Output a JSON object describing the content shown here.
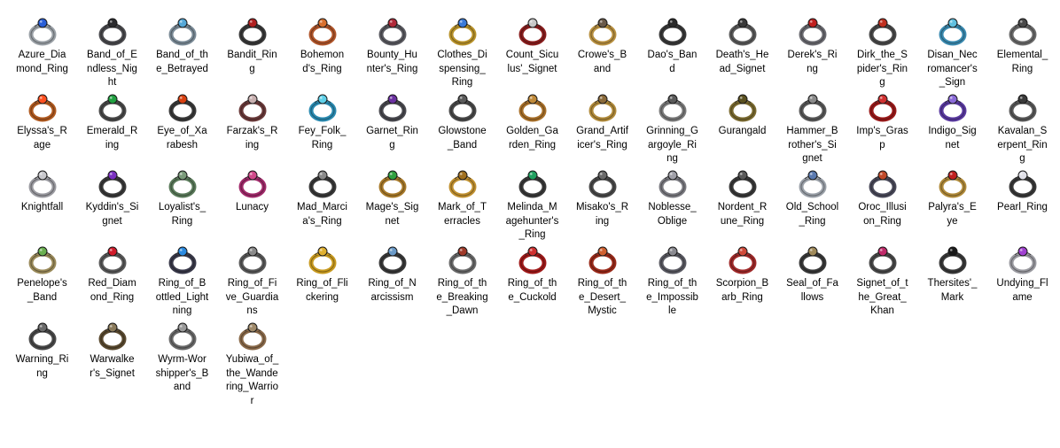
{
  "view": {
    "name": "ring-icons-folder"
  },
  "items": [
    {
      "name": "Azure_Diamond_Ring",
      "icon": "ring-icon",
      "metal": "#9aa0a6",
      "gem": "#2a5fd8"
    },
    {
      "name": "Band_of_Endless_Night",
      "icon": "ring-icon",
      "metal": "#4a4a4e",
      "gem": "#2b2b2e"
    },
    {
      "name": "Band_of_the_Betrayed",
      "icon": "ring-icon",
      "metal": "#7a8a96",
      "gem": "#55a8d8"
    },
    {
      "name": "Bandit_Ring",
      "icon": "ring-icon",
      "metal": "#3a3a3a",
      "gem": "#b02020"
    },
    {
      "name": "Bohemond's_Ring",
      "icon": "ring-icon",
      "metal": "#b0552a",
      "gem": "#d9702e"
    },
    {
      "name": "Bounty_Hunter's_Ring",
      "icon": "ring-icon",
      "metal": "#5a5a60",
      "gem": "#b02a3a"
    },
    {
      "name": "Clothes_Dispensing_Ring",
      "icon": "ring-icon",
      "metal": "#b8922a",
      "gem": "#3a7ad8"
    },
    {
      "name": "Count_Siculus'_Signet",
      "icon": "ring-icon",
      "metal": "#8a1e1e",
      "gem": "#c8c8c8"
    },
    {
      "name": "Crowe's_Band",
      "icon": "ring-icon",
      "metal": "#b89040",
      "gem": "#6a5a4a"
    },
    {
      "name": "Dao's_Band",
      "icon": "ring-icon",
      "metal": "#3a3a3a",
      "gem": "#2a2a2a"
    },
    {
      "name": "Death's_Head_Signet",
      "icon": "ring-icon",
      "metal": "#5a5a5a",
      "gem": "#3a3a3a"
    },
    {
      "name": "Derek's_Ring",
      "icon": "ring-icon",
      "metal": "#6a6a70",
      "gem": "#c02020"
    },
    {
      "name": "Dirk_the_Spider's_Ring",
      "icon": "ring-icon",
      "metal": "#4a4a4a",
      "gem": "#c03020"
    },
    {
      "name": "Disan_Necromancer's_Sign",
      "icon": "ring-icon",
      "metal": "#3a8ab0",
      "gem": "#60c0e0"
    },
    {
      "name": "Elemental_Ring",
      "icon": "ring-icon",
      "metal": "#6a6a6a",
      "gem": "#4a4a4a"
    },
    {
      "name": "Elyssa's_Rage",
      "icon": "ring-icon",
      "metal": "#b05a20",
      "gem": "#ff5020"
    },
    {
      "name": "Emerald_Ring",
      "icon": "ring-icon",
      "metal": "#4a4a4a",
      "gem": "#20a040"
    },
    {
      "name": "Eye_of_Xarabesh",
      "icon": "ring-icon",
      "metal": "#3a3a3a",
      "gem": "#d84010"
    },
    {
      "name": "Farzak's_Ring",
      "icon": "ring-icon",
      "metal": "#6a3a3a",
      "gem": "#c8b0b0"
    },
    {
      "name": "Fey_Folk_Ring",
      "icon": "ring-icon",
      "metal": "#2a8ab0",
      "gem": "#60d0e8"
    },
    {
      "name": "Garnet_Ring",
      "icon": "ring-icon",
      "metal": "#4a4a50",
      "gem": "#6a30a0"
    },
    {
      "name": "Glowstone_Band",
      "icon": "ring-icon",
      "metal": "#4a4a4a",
      "gem": "#5a5a5a"
    },
    {
      "name": "Golden_Garden_Ring",
      "icon": "ring-icon",
      "metal": "#a8702a",
      "gem": "#c08a3a"
    },
    {
      "name": "Grand_Artificer's_Ring",
      "icon": "ring-icon",
      "metal": "#b08a3a",
      "gem": "#8a6a3a"
    },
    {
      "name": "Grinning_Gargoyle_Ring",
      "icon": "ring-icon",
      "metal": "#7a7a7a",
      "gem": "#5a5a5a"
    },
    {
      "name": "Gurangald",
      "icon": "ring-icon",
      "metal": "#7a6a30",
      "gem": "#5a5020"
    },
    {
      "name": "Hammer_Brother's_Signet",
      "icon": "ring-icon",
      "metal": "#5a5a5a",
      "gem": "#8a8a8a"
    },
    {
      "name": "Imp's_Grasp",
      "icon": "ring-icon",
      "metal": "#9a1a1a",
      "gem": "#d03030"
    },
    {
      "name": "Indigo_Signet",
      "icon": "ring-icon",
      "metal": "#5a3aa0",
      "gem": "#8a6ad8"
    },
    {
      "name": "Kavalan_Serpent_Ring",
      "icon": "ring-icon",
      "metal": "#5a5a5a",
      "gem": "#3a3a3a"
    },
    {
      "name": "Knightfall",
      "icon": "ring-icon",
      "metal": "#9a9aa0",
      "gem": "#c8c8cc"
    },
    {
      "name": "Kyddin's_Signet",
      "icon": "ring-icon",
      "metal": "#3a3a3a",
      "gem": "#7a30c0"
    },
    {
      "name": "Loyalist's_Ring",
      "icon": "ring-icon",
      "metal": "#5a7a5a",
      "gem": "#7a9a7a"
    },
    {
      "name": "Lunacy",
      "icon": "ring-icon",
      "metal": "#a02a6a",
      "gem": "#d04a8a"
    },
    {
      "name": "Mad_Marcia's_Ring",
      "icon": "ring-icon",
      "metal": "#3a3a3a",
      "gem": "#8a8a8a"
    },
    {
      "name": "Mage's_Signet",
      "icon": "ring-icon",
      "metal": "#a87a2a",
      "gem": "#30a040"
    },
    {
      "name": "Mark_of_Terracles",
      "icon": "ring-icon",
      "metal": "#c09030",
      "gem": "#a07020"
    },
    {
      "name": "Melinda_Magehunter's_Ring",
      "icon": "ring-icon",
      "metal": "#3a3a3a",
      "gem": "#20a060"
    },
    {
      "name": "Misako's_Ring",
      "icon": "ring-icon",
      "metal": "#4a4a4a",
      "gem": "#6a6a6a"
    },
    {
      "name": "Noblesse_Oblige",
      "icon": "ring-icon",
      "metal": "#7a7a80",
      "gem": "#a0a0a8"
    },
    {
      "name": "Nordent_Rune_Ring",
      "icon": "ring-icon",
      "metal": "#3a3a3a",
      "gem": "#5a5a5a"
    },
    {
      "name": "Old_School_Ring",
      "icon": "ring-icon",
      "metal": "#9aa0a8",
      "gem": "#5a7ab0"
    },
    {
      "name": "Oroc_Illusion_Ring",
      "icon": "ring-icon",
      "metal": "#4a4a5a",
      "gem": "#c04a2a"
    },
    {
      "name": "Palyra's_Eye",
      "icon": "ring-icon",
      "metal": "#b08a3a",
      "gem": "#c02020"
    },
    {
      "name": "Pearl_Ring",
      "icon": "ring-icon",
      "metal": "#3a3a3a",
      "gem": "#e0e0e8"
    },
    {
      "name": "Penelope's_Band",
      "icon": "ring-icon",
      "metal": "#9a8a5a",
      "gem": "#6ab050"
    },
    {
      "name": "Red_Diamond_Ring",
      "icon": "ring-icon",
      "metal": "#5a5a5a",
      "gem": "#d01a2a"
    },
    {
      "name": "Ring_of_Bottled_Lightning",
      "icon": "ring-icon",
      "metal": "#3a3a4a",
      "gem": "#2a8ae0"
    },
    {
      "name": "Ring_of_Five_Guardians",
      "icon": "ring-icon",
      "metal": "#5a5a5a",
      "gem": "#8a8a8a"
    },
    {
      "name": "Ring_of_Flickering",
      "icon": "ring-icon",
      "metal": "#c89a20",
      "gem": "#e0b030"
    },
    {
      "name": "Ring_of_Narcissism",
      "icon": "ring-icon",
      "metal": "#3a3a3a",
      "gem": "#6a9ac8"
    },
    {
      "name": "Ring_of_the_Breaking_Dawn",
      "icon": "ring-icon",
      "metal": "#6a6a6a",
      "gem": "#a03a2a"
    },
    {
      "name": "Ring_of_the_Cuckold",
      "icon": "ring-icon",
      "metal": "#a01a1a",
      "gem": "#d03030"
    },
    {
      "name": "Ring_of_the_Desert_Mystic",
      "icon": "ring-icon",
      "metal": "#9a2a1a",
      "gem": "#d06030"
    },
    {
      "name": "Ring_of_the_Impossible",
      "icon": "ring-icon",
      "metal": "#5a5a62",
      "gem": "#8a8a90"
    },
    {
      "name": "Scorpion_Barb_Ring",
      "icon": "ring-icon",
      "metal": "#a02a2a",
      "gem": "#d04a3a"
    },
    {
      "name": "Seal_of_Fallows",
      "icon": "ring-icon",
      "metal": "#3a3a3a",
      "gem": "#a08a5a"
    },
    {
      "name": "Signet_of_the_Great_Khan",
      "icon": "ring-icon",
      "metal": "#4a4a4a",
      "gem": "#c02a6a"
    },
    {
      "name": "Thersites'_Mark",
      "icon": "ring-icon",
      "metal": "#3a3a3a",
      "gem": "#1a1a1a"
    },
    {
      "name": "Undying_Flame",
      "icon": "ring-icon",
      "metal": "#9a9aa0",
      "gem": "#a040d0"
    },
    {
      "name": "Warning_Ring",
      "icon": "ring-icon",
      "metal": "#4a4a4a",
      "gem": "#6a6a6a"
    },
    {
      "name": "Warwalker's_Signet",
      "icon": "ring-icon",
      "metal": "#5a4a30",
      "gem": "#8a7a5a"
    },
    {
      "name": "Wyrm-Worshipper's_Band",
      "icon": "ring-icon",
      "metal": "#6a6a6a",
      "gem": "#9a9a9a"
    },
    {
      "name": "Yubiwa_of_the_Wandering_Warrior",
      "icon": "ring-icon",
      "metal": "#8a6a4a",
      "gem": "#a08a6a"
    }
  ]
}
